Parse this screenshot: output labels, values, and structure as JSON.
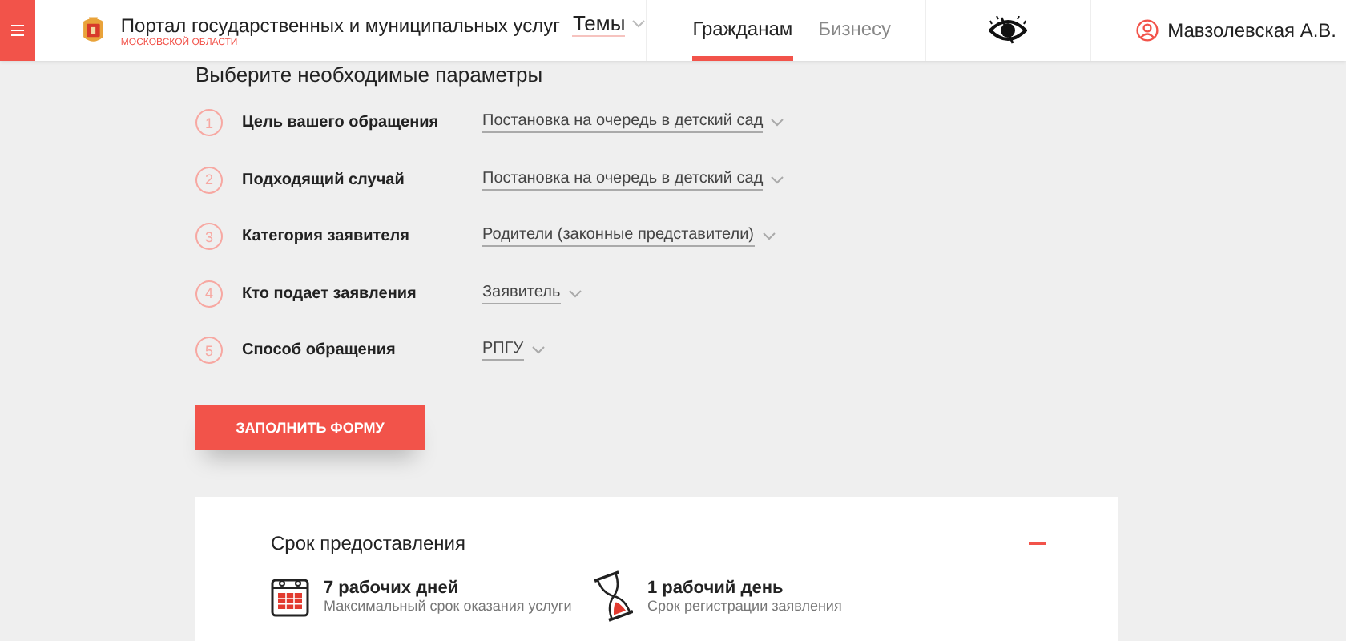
{
  "header": {
    "title": "Портал государственных и муниципальных услуг",
    "subtitle": "МОСКОВСКОЙ ОБЛАСТИ",
    "themes": "Темы",
    "tabs": [
      {
        "label": "Гражданам",
        "selected": true
      },
      {
        "label": "Бизнесу",
        "selected": false
      }
    ],
    "user": "Мавзолевская А.В."
  },
  "form": {
    "heading": "Выберите необходимые параметры",
    "rows": [
      {
        "number": "1",
        "label": "Цель вашего обращения",
        "value": "Постановка на очередь в детский сад"
      },
      {
        "number": "2",
        "label": "Подходящий случай",
        "value": "Постановка на очередь в детский сад"
      },
      {
        "number": "3",
        "label": "Категория заявителя",
        "value": "Родители (законные представители)"
      },
      {
        "number": "4",
        "label": "Кто подает заявления",
        "value": "Заявитель"
      },
      {
        "number": "5",
        "label": "Способ обращения",
        "value": "РПГУ"
      }
    ],
    "button": "ЗАПОЛНИТЬ ФОРМУ"
  },
  "term_card": {
    "title": "Срок предоставления",
    "expanded": true,
    "items": [
      {
        "kind": "calendar",
        "value": "7 рабочих дней",
        "caption": "Максимальный срок оказания услуги"
      },
      {
        "kind": "hourglass",
        "value": "1 рабочий день",
        "caption": "Срок регистрации заявления"
      }
    ]
  }
}
